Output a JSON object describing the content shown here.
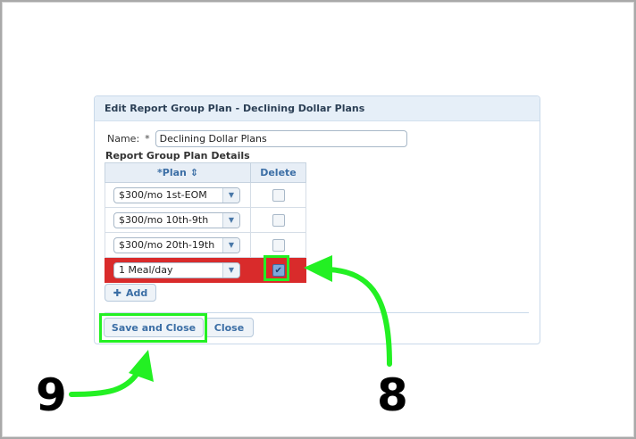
{
  "dialog": {
    "title": "Edit Report Group Plan - Declining Dollar Plans",
    "name_label": "Name:",
    "required_mark": "*",
    "name_value": "Declining Dollar Plans",
    "section_title": "Report Group Plan Details"
  },
  "table": {
    "headers": {
      "plan": "*Plan",
      "sort_icon": "⇕",
      "delete": "Delete"
    },
    "rows": [
      {
        "plan": "$300/mo 1st-EOM",
        "delete_checked": false
      },
      {
        "plan": "$300/mo 10th-9th",
        "delete_checked": false
      },
      {
        "plan": "$300/mo 20th-19th",
        "delete_checked": false
      },
      {
        "plan": "1 Meal/day",
        "delete_checked": true
      }
    ]
  },
  "buttons": {
    "add": "Add",
    "save_and_close": "Save and Close",
    "close": "Close"
  },
  "annotations": {
    "step_8": "8",
    "step_9": "9"
  },
  "colors": {
    "highlight_row": "#d92b2b",
    "annotation_green": "#23f023",
    "header_bg": "#e6eff8",
    "accent_text": "#3b6ea5"
  }
}
